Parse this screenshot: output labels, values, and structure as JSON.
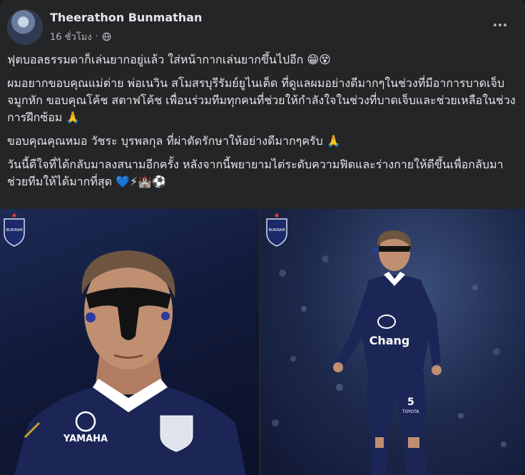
{
  "post": {
    "author": "Theerathon Bunmathan",
    "time": "16 ชั่วโมง",
    "paragraphs": [
      "ฟุตบอลธรรมดาก็เล่นยากอยู่แล้ว ใส่หน้ากากเล่นยากขึ้นไปอีก 😁😵",
      "ผมอยากขอบคุณแม่ต่าย พ่อเนวิน สโมสรบุรีรัมย์ยูไนเต็ด ที่ดูแลผมอย่างดีมากๆในช่วงที่มีอาการบาดเจ็บจมูกหัก ขอบคุณโค้ช สตาฟโค้ช เพื่อนร่วมทีมทุกคนที่ช่วยให้กำลังใจในช่วงที่บาดเจ็บและช่วยเหลือในช่วงการฝึกซ้อม 🙏",
      "ขอบคุณคุณหมอ วัชระ บุรพลกุล ที่ผ่าตัดรักษาให้อย่างดีมากๆครับ 🙏",
      "วันนี้ดีใจที่ได้กลับมาลงสนามอีกครั้ง หลังจากนี้พยายามไต่ระดับความฟิตและร่างกายให้ดีขึ้นเพื่อกลับมาช่วยทีมให้ได้มากที่สุด 💙⚡🏰⚽"
    ]
  },
  "photos": {
    "left": {
      "shirt_sponsor": "YAMAHA",
      "crest_text": "BURIRAM"
    },
    "right": {
      "crest_text": "BURIRAM",
      "shirt_sponsor": "Chang",
      "shirt_number": "5",
      "shorts_sponsor": "TOYOTA"
    }
  },
  "colors": {
    "card_bg": "#242526",
    "text": "#e4e6eb",
    "muted": "#b0b3b8",
    "kit": "#1b2656"
  }
}
